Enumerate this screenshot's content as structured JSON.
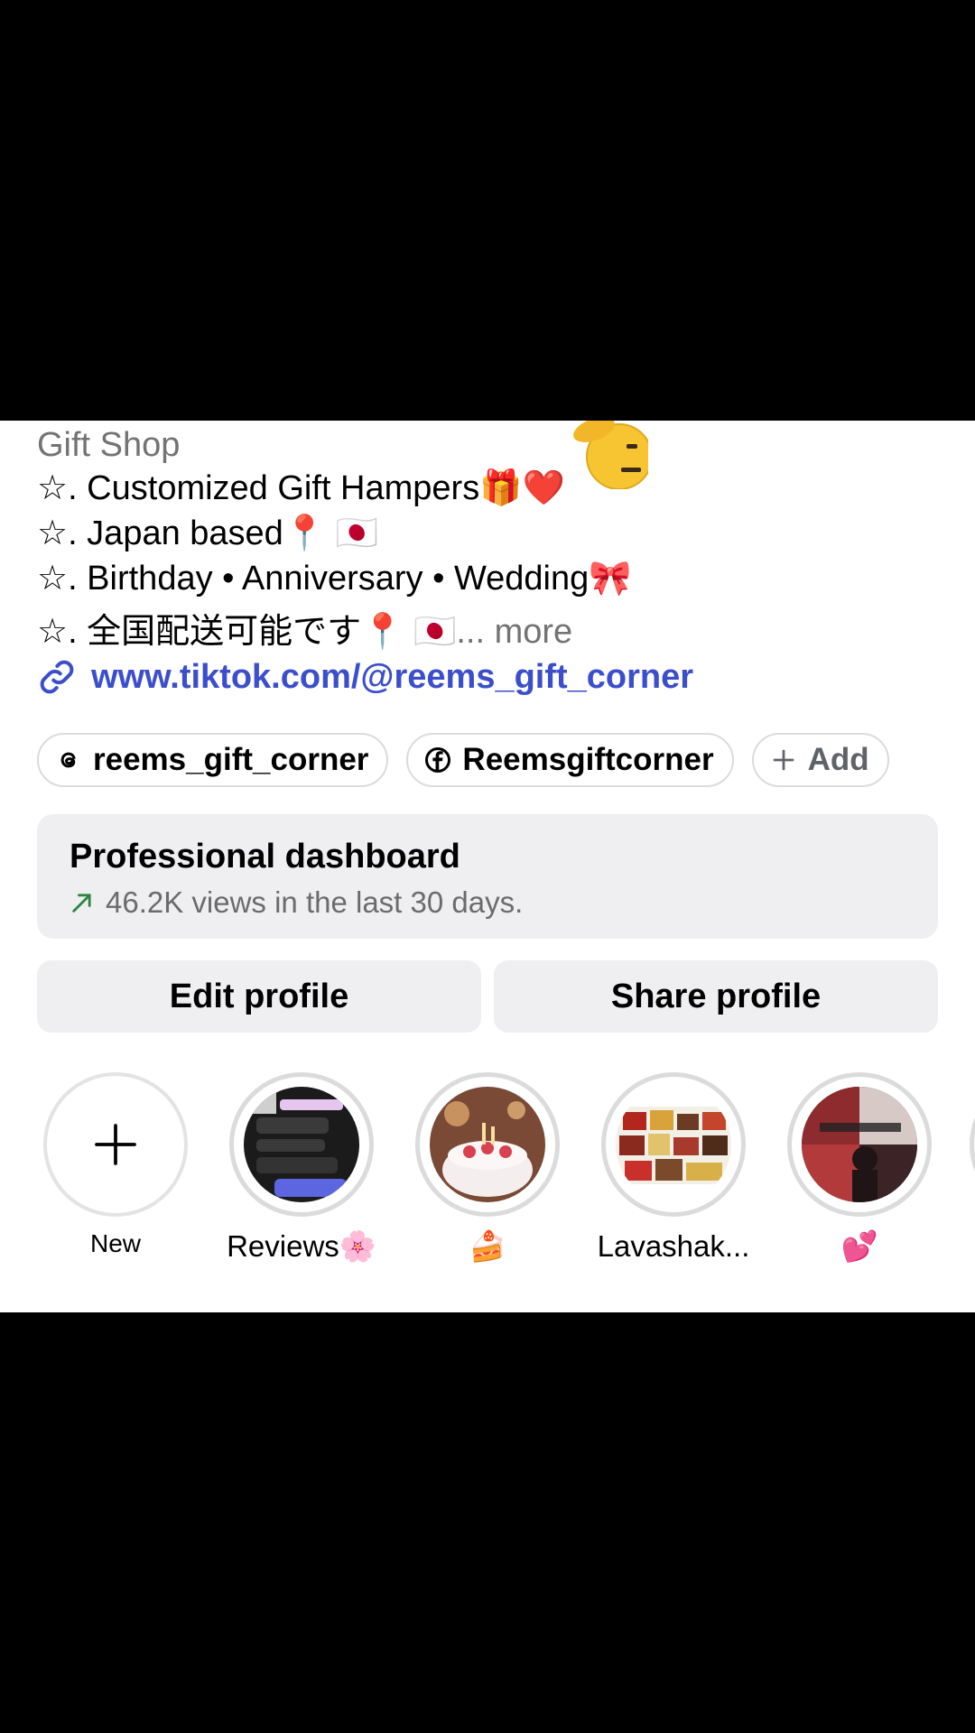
{
  "profile": {
    "category": "Gift Shop",
    "bio": [
      "☆. Customized Gift Hampers🎁❤️",
      "☆. Japan based📍 🇯🇵",
      "☆. Birthday • Anniversary • Wedding🎀",
      "☆. 全国配送可能です📍 🇯🇵"
    ],
    "bio_more": "... more",
    "sticker_icon": "saluting-face-emoji",
    "link_icon": "link-icon",
    "link": "www.tiktok.com/@reems_gift_corner"
  },
  "chips": [
    {
      "icon": "threads-icon",
      "label": "reems_gift_corner"
    },
    {
      "icon": "facebook-icon",
      "label": "Reemsgiftcorner"
    },
    {
      "icon": "plus-icon",
      "label": "Add"
    }
  ],
  "dashboard": {
    "title": "Professional dashboard",
    "trend_icon": "trend-up-arrow-icon",
    "subtitle": "46.2K views in the last 30 days.",
    "trend_color": "#2e8540"
  },
  "buttons": {
    "edit": "Edit profile",
    "share": "Share profile"
  },
  "highlights": [
    {
      "label": "New",
      "icon": "plus-icon"
    },
    {
      "label": "Reviews🌸"
    },
    {
      "label": "🍰"
    },
    {
      "label": "Lavashak..."
    },
    {
      "label": "💕"
    }
  ],
  "colors": {
    "link": "#3b4fcc",
    "secondary_text": "#737373",
    "button_bg": "#efeff2",
    "ring": "#dbdbdb"
  }
}
